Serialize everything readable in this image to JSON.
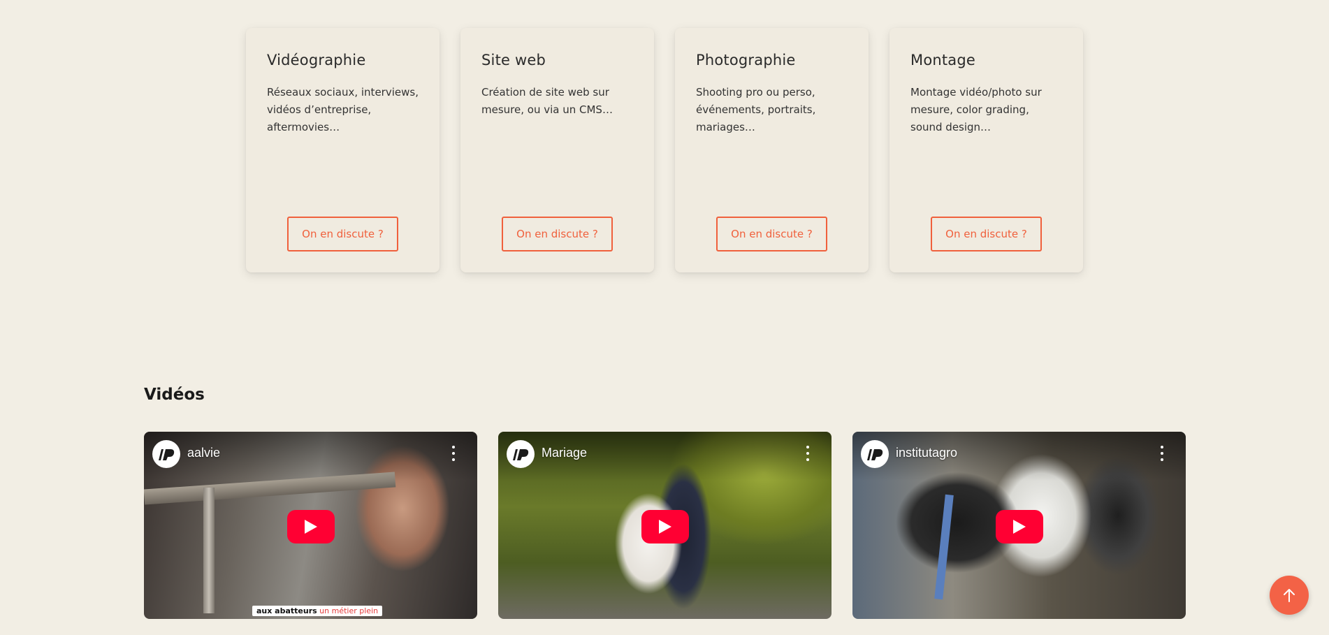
{
  "services": {
    "cards": [
      {
        "title": "Vidéographie",
        "description": "Réseaux sociaux, interviews, vidéos d’entreprise, aftermovies…",
        "button": "On en discute ?"
      },
      {
        "title": "Site web",
        "description": "Création de site web sur mesure, ou via un CMS…",
        "button": "On en discute ?"
      },
      {
        "title": "Photographie",
        "description": "Shooting pro ou perso, événements, portraits, mariages…",
        "button": "On en discute ?"
      },
      {
        "title": "Montage",
        "description": "Montage vidéo/photo sur mesure, color grading, sound design…",
        "button": "On en discute ?"
      }
    ]
  },
  "videos": {
    "heading": "Vidéos",
    "items": [
      {
        "title": "aalvie",
        "caption_bold": "aux abatteurs",
        "caption_rest": " un métier plein"
      },
      {
        "title": "Mariage"
      },
      {
        "title": "institutagro"
      }
    ]
  },
  "colors": {
    "accent": "#f0603c",
    "background": "#f2eee4",
    "card": "#f0ebe0",
    "youtube_red": "#ff0033"
  },
  "icons": {
    "channel": "channel-logo-icon",
    "menu": "more-vert-icon",
    "play": "play-icon",
    "back_to_top": "arrow-up-icon"
  }
}
